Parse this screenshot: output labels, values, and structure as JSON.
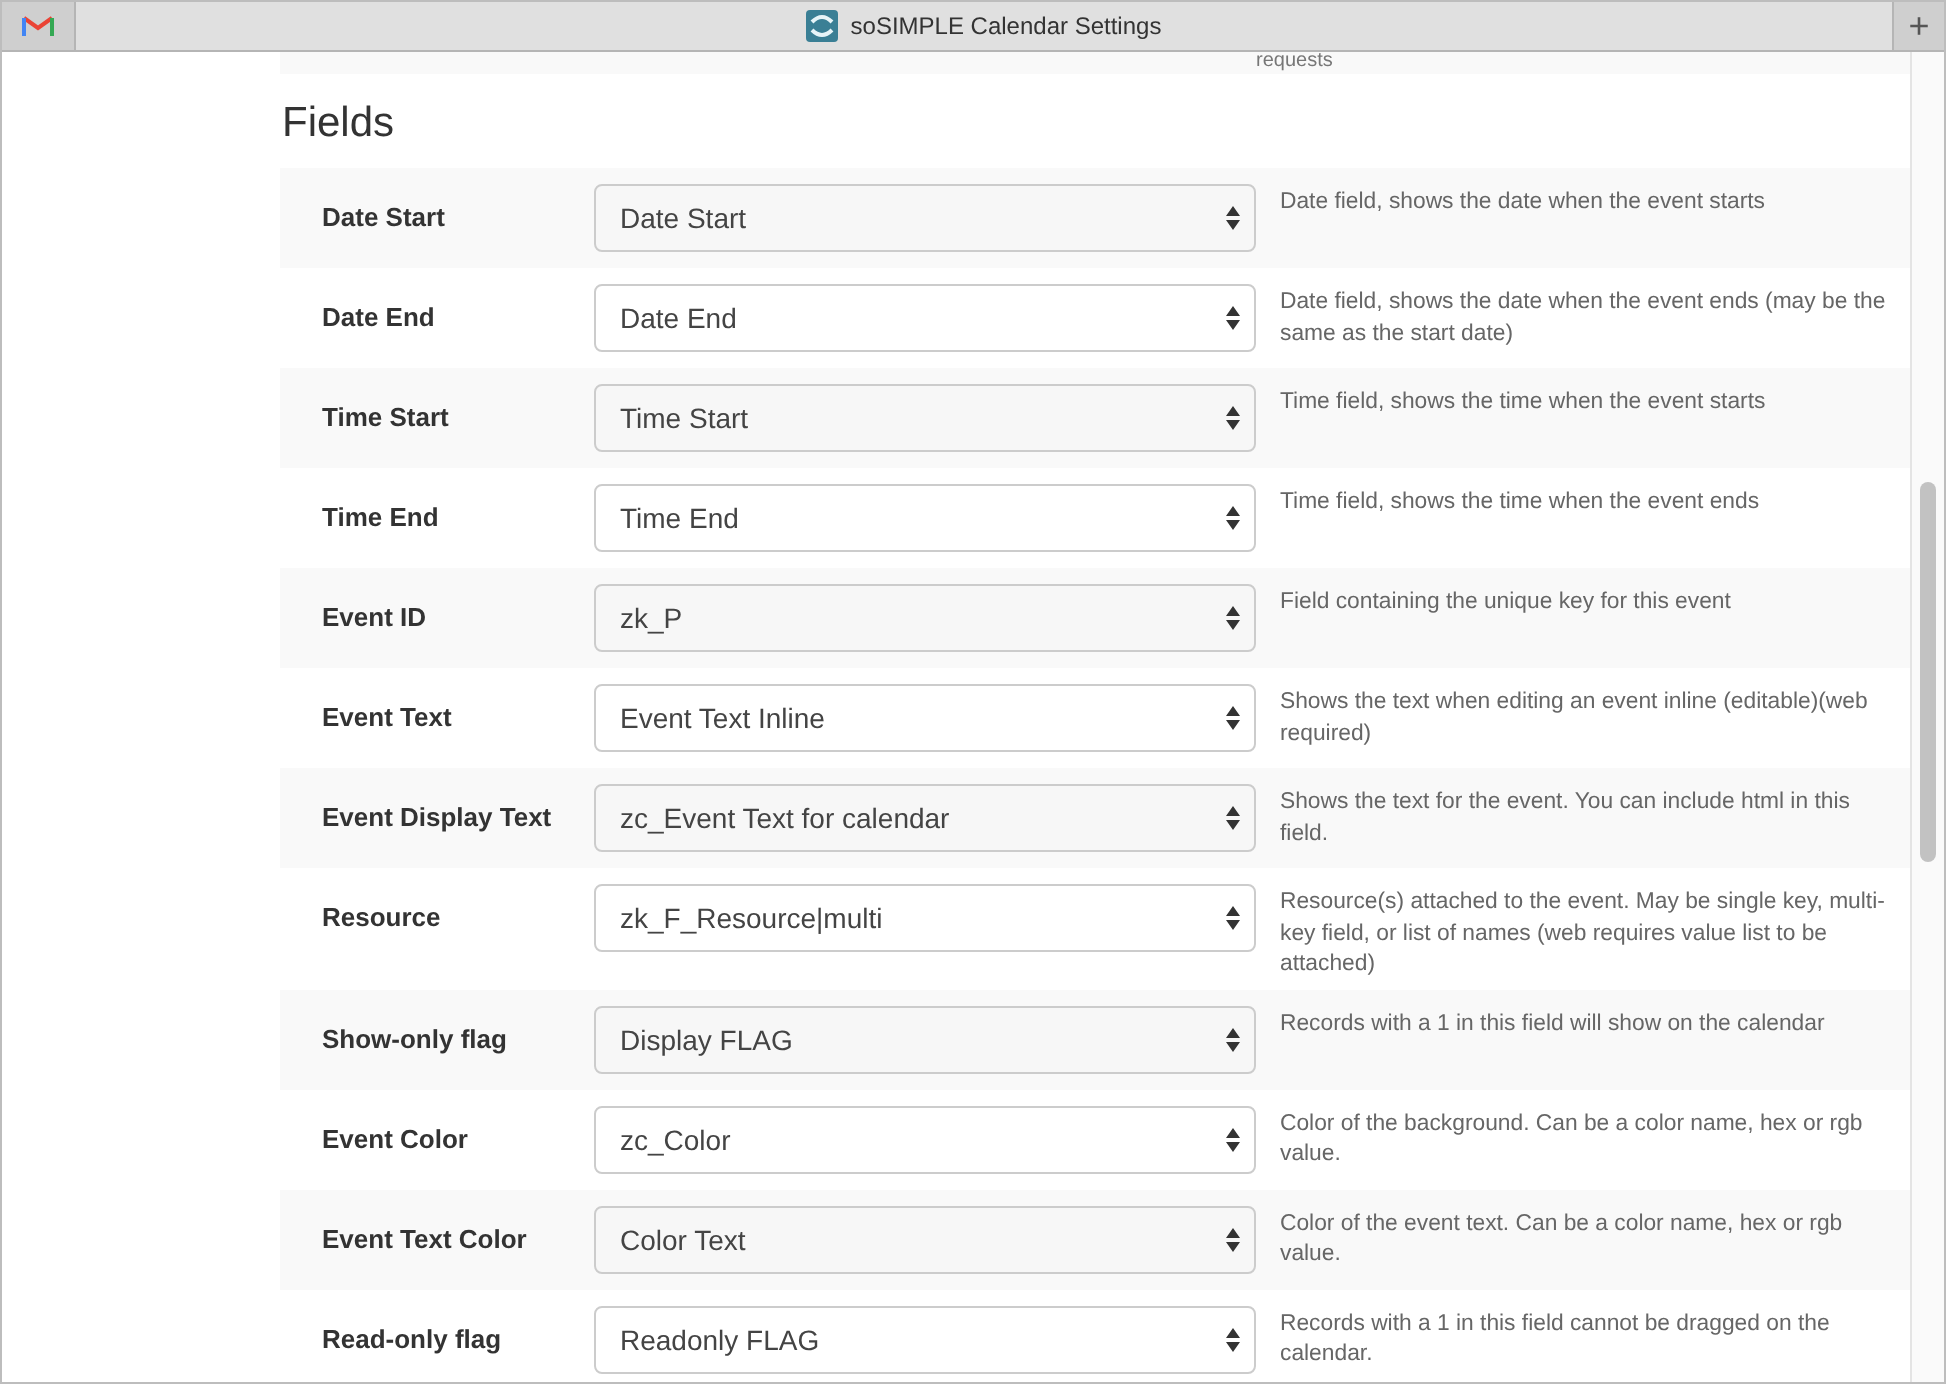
{
  "window": {
    "title": "soSIMPLE Calendar Settings",
    "new_tab": "+"
  },
  "previous_section": {
    "cut_text": "requests"
  },
  "section": {
    "title": "Fields"
  },
  "rows": [
    {
      "label": "Date Start",
      "value": "Date Start",
      "description": "Date field, shows the date when the event starts"
    },
    {
      "label": "Date End",
      "value": "Date End",
      "description": "Date field, shows the date when the event ends (may be the same as the start date)"
    },
    {
      "label": "Time Start",
      "value": "Time Start",
      "description": "Time field, shows the time when the event starts"
    },
    {
      "label": "Time End",
      "value": "Time End",
      "description": "Time field, shows the time when the event ends"
    },
    {
      "label": "Event ID",
      "value": "zk_P",
      "description": "Field containing the unique key for this event"
    },
    {
      "label": "Event Text",
      "value": "Event Text Inline",
      "description": "Shows the text when editing an event inline (editable)(web required)"
    },
    {
      "label": "Event Display Text",
      "value": "zc_Event Text for calendar",
      "description": "Shows the text for the event. You can include html in this field."
    },
    {
      "label": "Resource",
      "value": "zk_F_Resource|multi",
      "description": "Resource(s) attached to the event. May be single key, multi-key field, or list of names (web requires value list to be attached)"
    },
    {
      "label": "Show-only flag",
      "value": "Display FLAG",
      "description": "Records with a 1 in this field will show on the calendar"
    },
    {
      "label": "Event Color",
      "value": "zc_Color",
      "description": "Color of the background. Can be a color name, hex or rgb value."
    },
    {
      "label": "Event Text Color",
      "value": "Color Text",
      "description": "Color of the event text. Can be a color name, hex or rgb value."
    },
    {
      "label": "Read-only flag",
      "value": "Readonly FLAG",
      "description": "Records with a 1 in this field cannot be dragged on the calendar."
    }
  ]
}
